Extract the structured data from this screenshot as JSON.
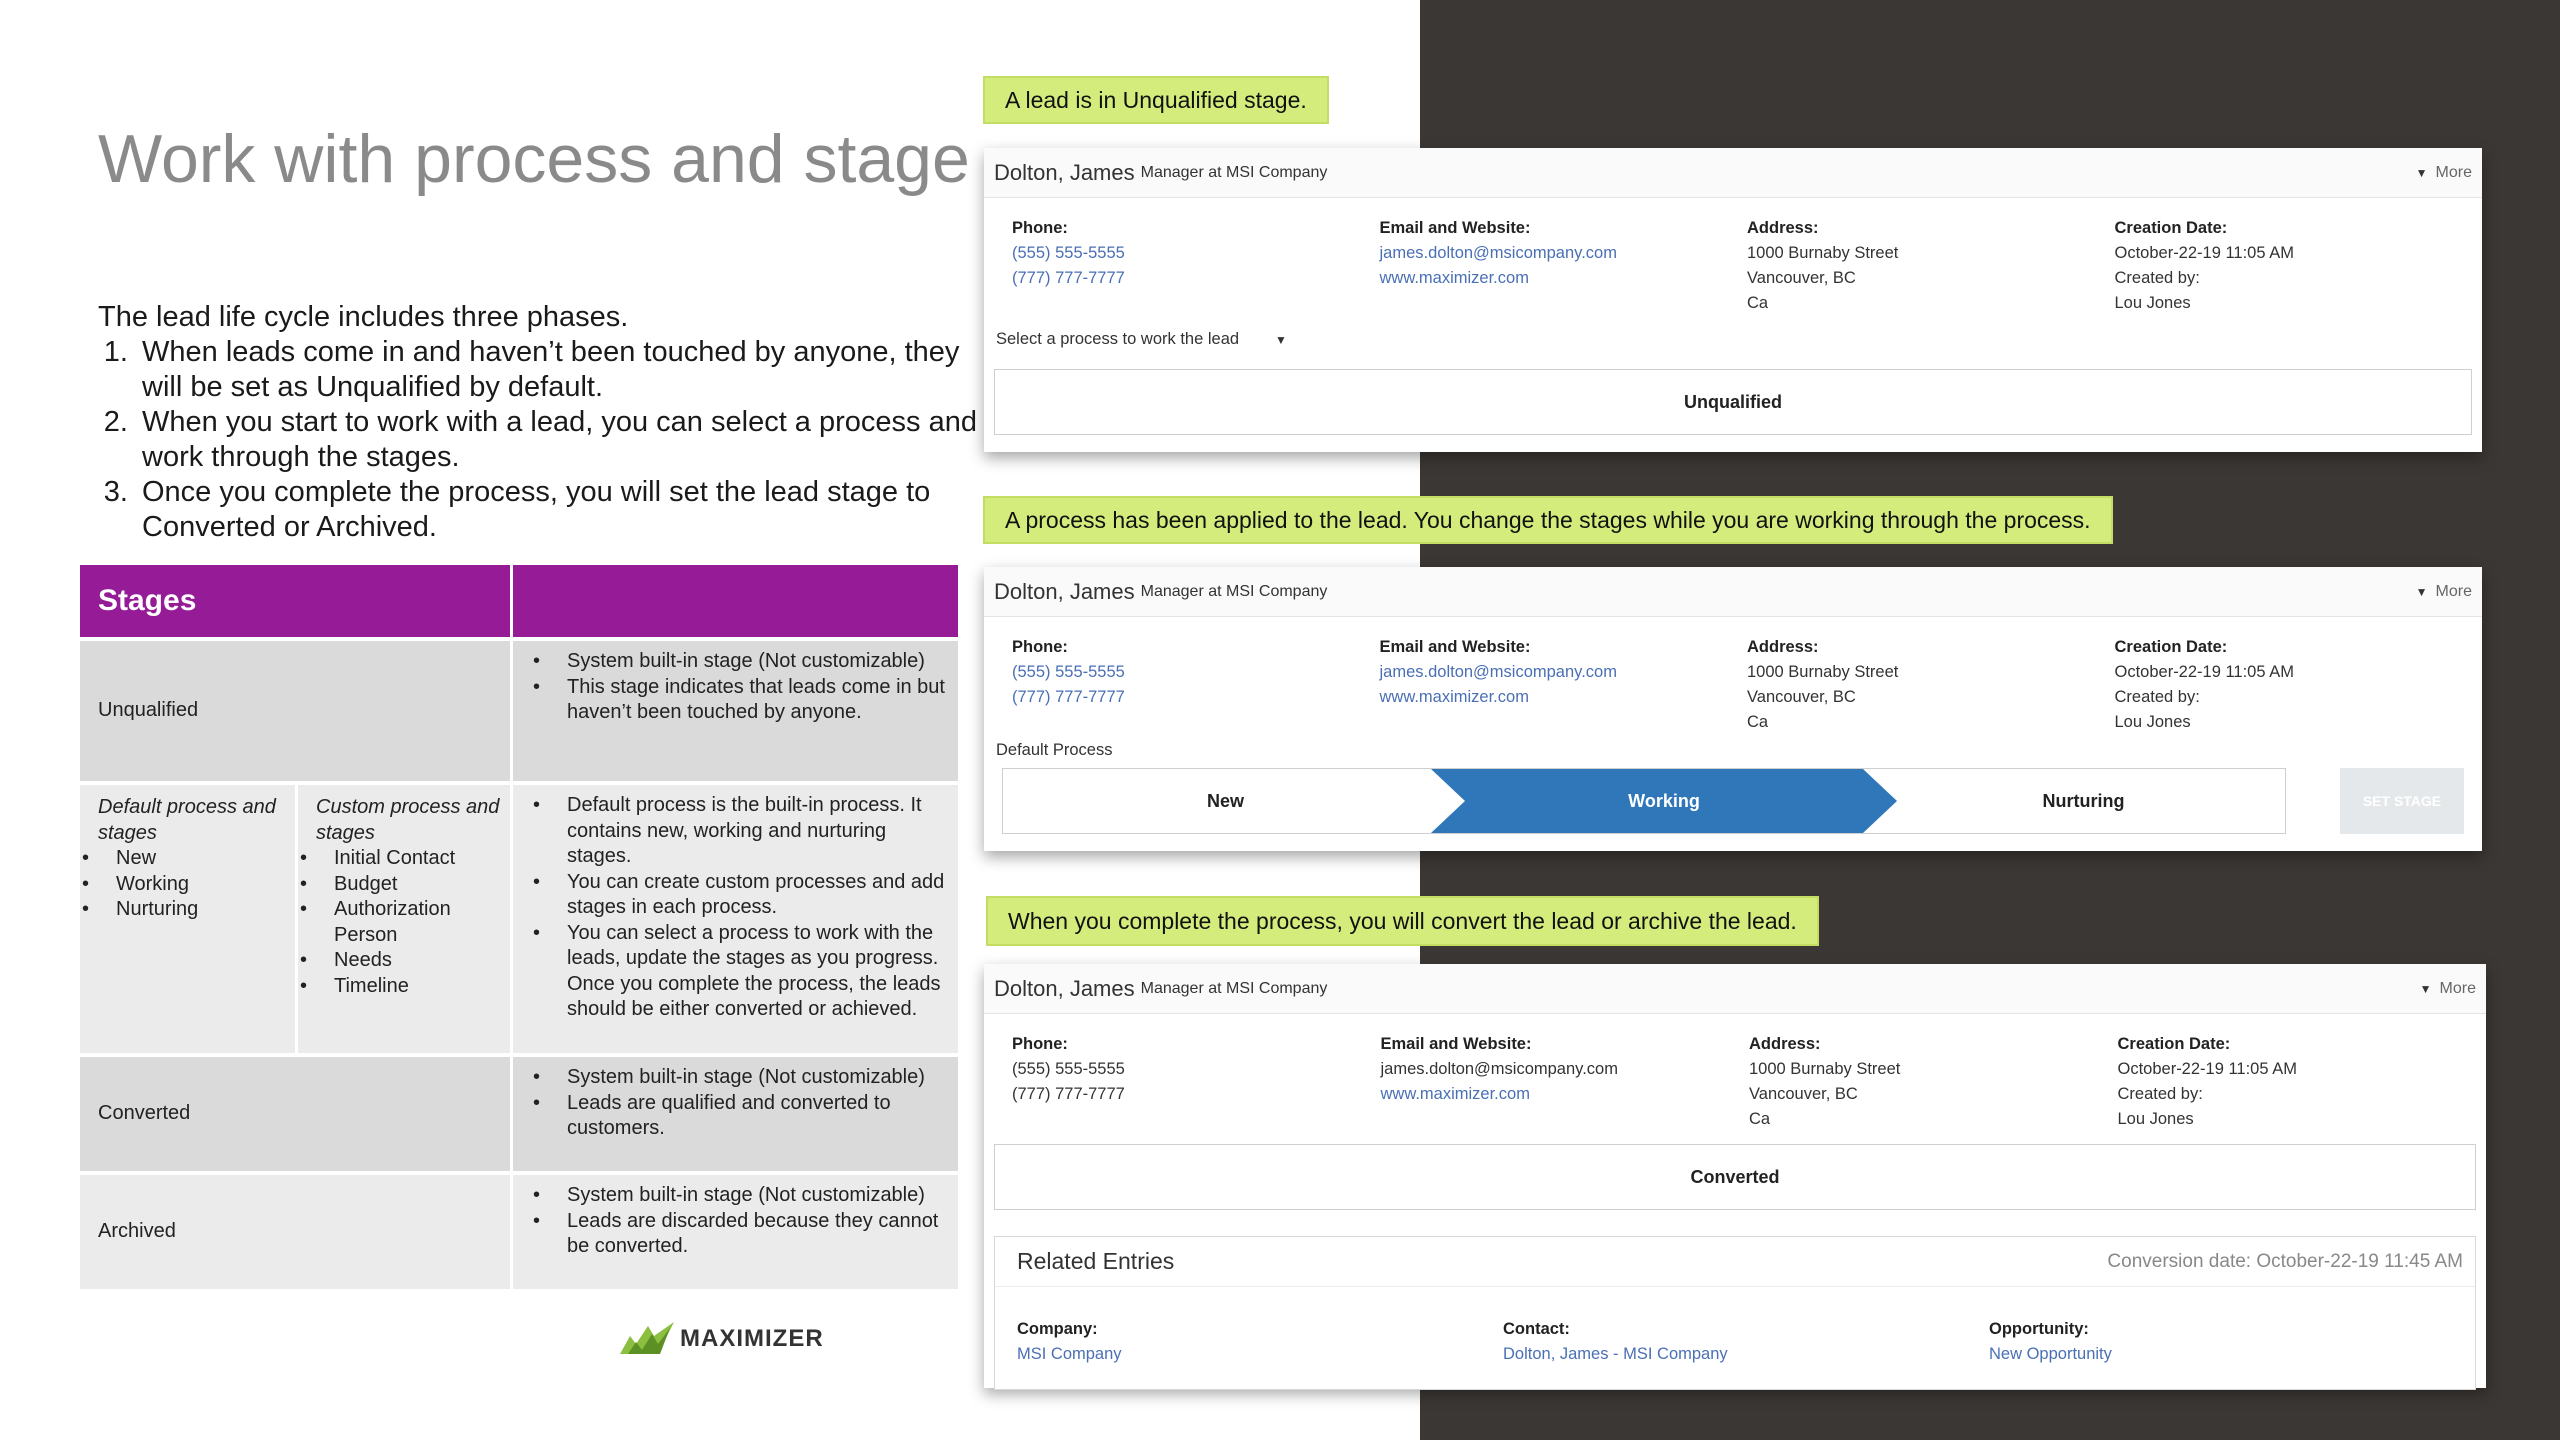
{
  "slide": {
    "title": "Work with process and stage",
    "intro": "The lead life cycle includes three phases.",
    "steps": [
      "When leads come in and haven’t been touched by anyone, they will be set as Unqualified by default.",
      "When you start to work with a lead, you can select a process and work through the stages.",
      "Once you complete the process, you will set the lead stage to Converted or Archived."
    ],
    "logo_text": "MAXIMIZER"
  },
  "table": {
    "header": "Stages",
    "header_b": "",
    "rows": {
      "unqualified": {
        "name": "Unqualified",
        "bullets": [
          "System built-in stage (Not customizable)",
          "This stage indicates that leads come in but haven’t been touched by anyone."
        ]
      },
      "process": {
        "default_title": "Default process and stages",
        "default_items": [
          "New",
          "Working",
          "Nurturing"
        ],
        "custom_title": "Custom process and stages",
        "custom_items": [
          "Initial Contact",
          "Budget",
          "Authorization Person",
          "Needs",
          "Timeline"
        ],
        "bullets": [
          "Default process is the built-in process. It contains new, working and nurturing stages.",
          "You can create custom processes and add stages in each process.",
          "You can select a process to work with the leads, update the stages as you progress. Once you complete the process, the leads should be either converted or achieved."
        ]
      },
      "converted": {
        "name": "Converted",
        "bullets": [
          "System built-in stage (Not customizable)",
          "Leads are qualified and converted to customers."
        ]
      },
      "archived": {
        "name": "Archived",
        "bullets": [
          "System built-in stage (Not customizable)",
          "Leads are discarded because they cannot be converted."
        ]
      }
    }
  },
  "callouts": {
    "one": "A lead is in Unqualified stage.",
    "two": "A process has been applied to the lead. You change the stages while you are working through the process.",
    "three": "When you complete the process, you will convert the lead or archive the lead."
  },
  "lead": {
    "name": "Dolton, James",
    "subtitle": "Manager at MSI Company",
    "more": "More",
    "phone_label": "Phone:",
    "phone1": "(555) 555-5555",
    "phone2": "(777) 777-7777",
    "email_label": "Email and Website:",
    "email": "james.dolton@msicompany.com",
    "website": "www.maximizer.com",
    "address_label": "Address:",
    "address1": "1000 Burnaby Street",
    "address2": "Vancouver, BC",
    "address3": "Ca",
    "created_label": "Creation Date:",
    "created_date": "October-22-19 11:05 AM",
    "created_by_label": "Created by:",
    "created_by": "Lou Jones"
  },
  "card1": {
    "process_prompt": "Select a process to work the lead",
    "stage": "Unqualified"
  },
  "card2": {
    "process_name": "Default Process",
    "stages": [
      "New",
      "Working",
      "Nurturing"
    ],
    "active_stage": "Working",
    "set_stage": "SET STAGE",
    "active_color": "#2f77b9"
  },
  "card3": {
    "stage": "Converted",
    "related_title": "Related Entries",
    "conversion": "Conversion date: October-22-19 11:45 AM",
    "company_label": "Company:",
    "company": "MSI Company",
    "contact_label": "Contact:",
    "contact": "Dolton, James - MSI Company",
    "opportunity_label": "Opportunity:",
    "opportunity": "New Opportunity"
  },
  "colors": {
    "accent": "#951b97",
    "callout": "#d4ec7c",
    "dark_panel": "#3b3734",
    "link": "#4a6fb5"
  }
}
